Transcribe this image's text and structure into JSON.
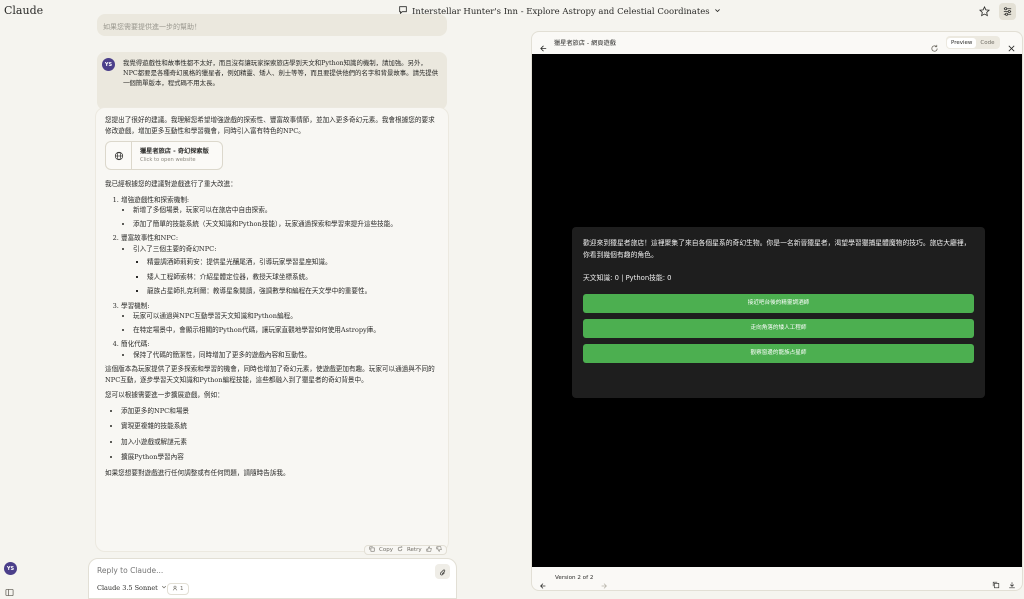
{
  "app": {
    "brand": "Claude"
  },
  "header": {
    "title": "Interstellar Hunter's Inn - Explore Astropy and Celestial Coordinates"
  },
  "user": {
    "initials": "YS"
  },
  "chat": {
    "prev_fade": "如果您需要提供進一步的幫助！",
    "user_message": "我覺得遊戲性和故事性都不太好，而且沒有讓玩家探索旅店學到天文和Python知識的機制，請加強。另外，NPC都要是各種奇幻風格的獵星者，例如精靈、矮人、劍士等等，而且要提供他們的名字和背景故事。請先提供一個簡單版本，程式碼不用太長。",
    "reply": {
      "intro": "您提出了很好的建議。我理解您希望增強遊戲的探索性、豐富故事情節，並加入更多奇幻元素。我會根據您的要求修改遊戲，增加更多互動性和學習機會，同時引入富有特色的NPC。",
      "artifact_title": "獵星者旅店 - 奇幻探索版",
      "artifact_sub": "Click to open website",
      "changes_intro": "我已經根據您的建議對遊戲進行了重大改進：",
      "sections": [
        {
          "title": "增強遊戲性和探索機制:",
          "items": [
            {
              "text": "新增了多個場景，玩家可以在旅店中自由探索。",
              "children": []
            },
            {
              "text": "添加了簡單的技能系統（天文知識和Python技能），玩家通過探索和學習來提升這些技能。",
              "children": []
            }
          ]
        },
        {
          "title": "豐富故事性和NPC:",
          "items": [
            {
              "text": "引入了三個主要的奇幻NPC:",
              "children": [
                "精靈調酒師莉莉安：提供星光釀尾酒，引導玩家學習星座知識。",
                "矮人工程師索林：介紹星體定位器，教授天球坐標系統。",
                "龍族占星師扎克利爾：教導星象閱讀，強調數學和編程在天文學中的重要性。"
              ]
            }
          ]
        },
        {
          "title": "學習機制:",
          "items": [
            {
              "text": "玩家可以通過與NPC互動學習天文知識和Python編程。",
              "children": []
            },
            {
              "text": "在特定場景中，會顯示相關的Python代碼，讓玩家直觀地學習如何使用Astropy庫。",
              "children": []
            }
          ]
        },
        {
          "title": "簡化代碼:",
          "items": [
            {
              "text": "保持了代碼的簡潔性，同時增加了更多的遊戲內容和互動性。",
              "children": []
            }
          ]
        }
      ],
      "summary": "這個版本為玩家提供了更多探索和學習的機會，同時也增加了奇幻元素，使遊戲更加有趣。玩家可以通過與不同的NPC互動，逐步學習天文知識和Python編程技能，這些都融入到了獵星者的奇幻背景中。",
      "expand_intro": "您可以根據需要進一步擴展遊戲，例如：",
      "expand_items": [
        "添加更多的NPC和場景",
        "實現更複雜的技能系統",
        "加入小遊戲或解謎元素",
        "擴展Python學習內容"
      ],
      "closing": "如果您想要對遊戲進行任何調整或有任何問題，請隨時告訴我。"
    },
    "actions": {
      "copy": "Copy",
      "retry": "Retry"
    }
  },
  "composer": {
    "placeholder": "Reply to Claude...",
    "model": "Claude 3.5 Sonnet",
    "people_count": "1"
  },
  "panel": {
    "title": "獵星者旅店 - 網頁遊戲",
    "toggle_preview": "Preview",
    "toggle_code": "Code",
    "version": "Version 2 of 2",
    "game": {
      "intro": "歡迎來到獵星者旅店！這裡聚集了來自各個星系的奇幻生物。你是一名新晉獵星者，渴望學習獵捕星體魔物的技巧。旅店大廳裡，你看到幾個有趣的角色。",
      "stats": "天文知識: 0 | Python技能: 0",
      "buttons": [
        "接近吧台後的精靈調酒師",
        "走向角落的矮人工程師",
        "觀察窗邊的龍族占星師"
      ]
    }
  },
  "colors": {
    "background": "#f5f4ef",
    "game_bg": "#000000",
    "game_card": "#1e1e1e",
    "game_button": "#4caf50",
    "avatar": "#4b3f8a"
  },
  "icons": {
    "chat": "chat-bubble-icon",
    "star": "star-icon",
    "settings": "sliders-icon",
    "globe": "globe-icon",
    "back": "arrow-left-icon",
    "refresh": "refresh-icon",
    "close": "close-icon",
    "copy": "copy-icon",
    "download": "download-icon",
    "attach": "paperclip-icon"
  }
}
